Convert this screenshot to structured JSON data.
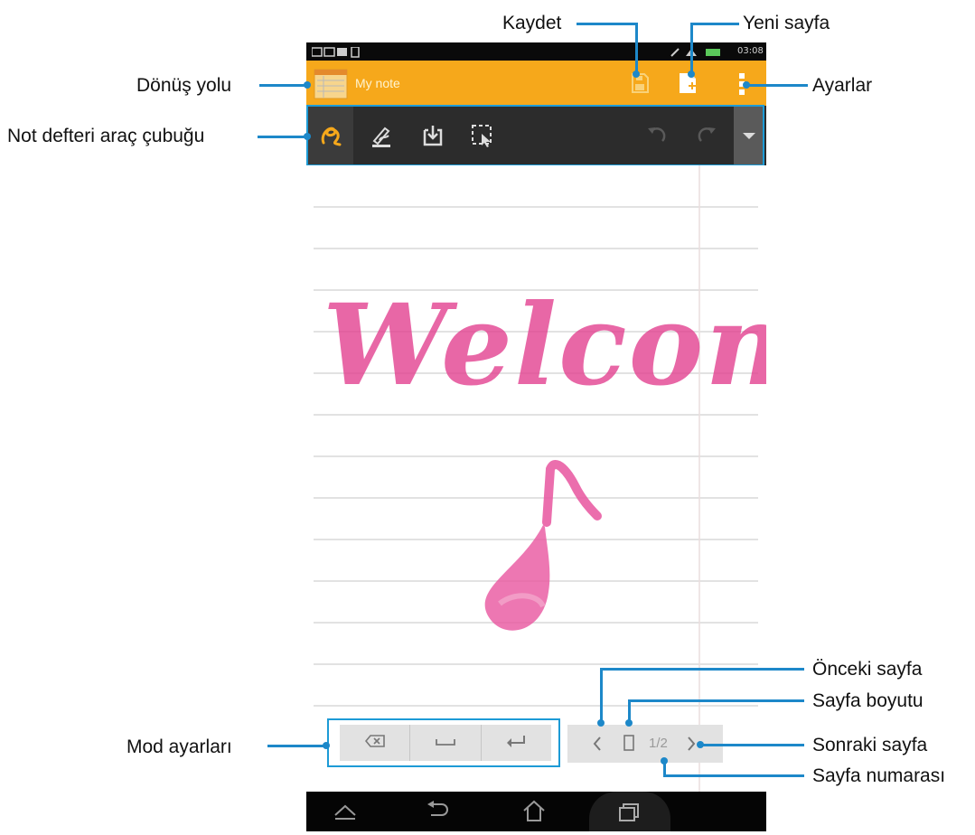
{
  "status_bar": {
    "time": "03:08"
  },
  "app_bar": {
    "note_title": "My note",
    "icons": [
      "notebook-icon",
      "save-icon",
      "new-page-icon",
      "overflow-menu-icon"
    ]
  },
  "toolbar": {
    "icons": [
      "handwriting-mode-icon",
      "pen-settings-icon",
      "insert-icon",
      "selection-icon",
      "undo-icon",
      "redo-icon",
      "expand-chevron-icon"
    ]
  },
  "canvas": {
    "handwritten_text": "Welcome"
  },
  "mode_bar": {
    "icons": [
      "backspace-icon",
      "space-icon",
      "enter-icon"
    ]
  },
  "pager": {
    "page_number": "1/2"
  },
  "callouts": {
    "save": "Kaydet",
    "new_page": "Yeni sayfa",
    "return_path": "Dönüş yolu",
    "settings": "Ayarlar",
    "notebook_toolbar": "Not defteri araç çubuğu",
    "mode_settings": "Mod ayarları",
    "previous_page": "Önceki sayfa",
    "page_size": "Sayfa boyutu",
    "next_page": "Sonraki sayfa",
    "page_number": "Sayfa numarası"
  },
  "colors": {
    "app_bar": "#f6a81b",
    "toolbar": "#2c2c2c",
    "accent": "#1d9bd6",
    "ink": "#e23d8e"
  }
}
